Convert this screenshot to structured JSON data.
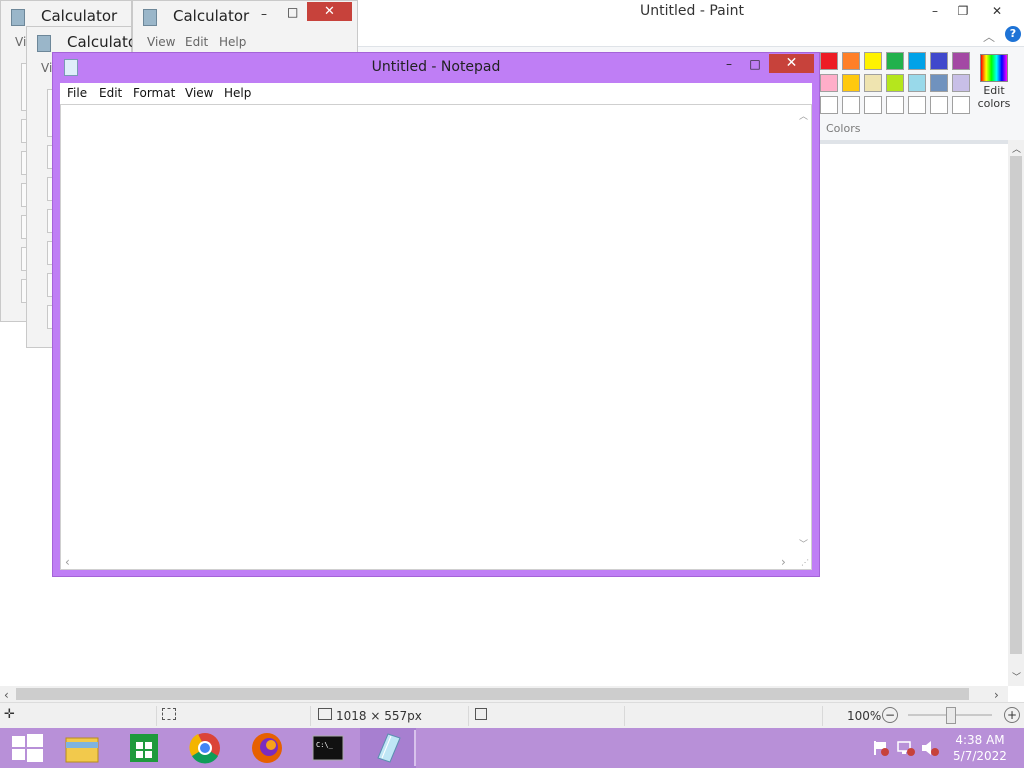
{
  "paint": {
    "title": "Untitled - Paint",
    "caption_buttons": {
      "minimize": "–",
      "maximize": "❐",
      "close": "✕"
    },
    "help_icon": "help-icon",
    "colors_label": "Colors",
    "edit_colors_label": "Edit colors",
    "palette_row1": [
      "#ed1c24",
      "#ff7f27",
      "#fff200",
      "#22b14c",
      "#00a2e8",
      "#3f48cc",
      "#a349a4"
    ],
    "palette_row2": [
      "#ffaec9",
      "#ffc90e",
      "#efe4b0",
      "#b5e61d",
      "#99d9ea",
      "#7092be",
      "#c8bfe7"
    ],
    "palette_row3": [
      "#ffffff",
      "#ffffff",
      "#ffffff",
      "#ffffff",
      "#ffffff",
      "#ffffff",
      "#ffffff"
    ],
    "status": {
      "image_size": "1018 × 557px",
      "zoom": "100%",
      "zoom_out": "−",
      "zoom_in": "+"
    }
  },
  "calculators": [
    {
      "title": "Calculator",
      "menu": "Vi"
    },
    {
      "title": "Calculator",
      "menu": [
        "View",
        "Edit",
        "Help"
      ]
    },
    {
      "title": "Calculato",
      "menu": "Vi"
    }
  ],
  "notepad": {
    "title": "Untitled - Notepad",
    "menu": [
      "File",
      "Edit",
      "Format",
      "View",
      "Help"
    ],
    "content": "",
    "caption_buttons": {
      "minimize": "–",
      "maximize": "□",
      "close": "✕"
    }
  },
  "taskbar": {
    "time": "4:38 AM",
    "date": "5/7/2022",
    "apps": [
      "start-icon",
      "file-explorer-icon",
      "store-icon",
      "chrome-icon",
      "firefox-icon",
      "cmd-icon",
      "notepad-icon"
    ]
  },
  "colors": {
    "notepad_frame": "#bf7ef5",
    "taskbar": "#b890d8",
    "close_red": "#c7423b"
  }
}
